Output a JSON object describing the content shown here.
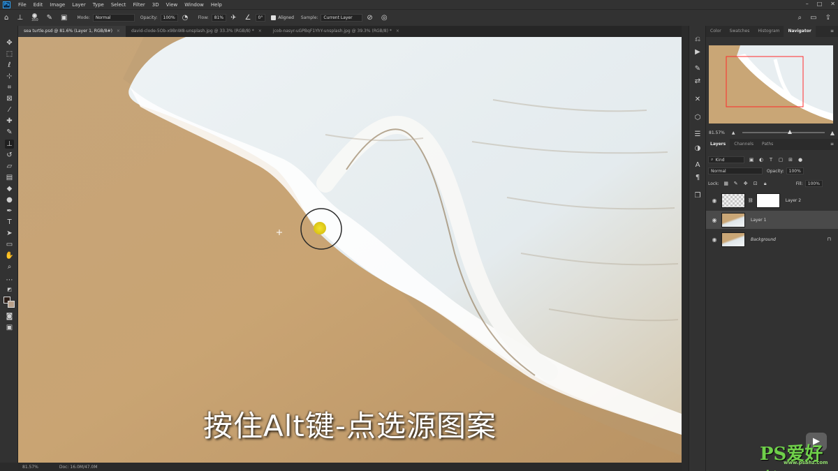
{
  "app": {
    "logo": "Ps"
  },
  "menu": [
    "File",
    "Edit",
    "Image",
    "Layer",
    "Type",
    "Select",
    "Filter",
    "3D",
    "View",
    "Window",
    "Help"
  ],
  "window_controls": [
    "–",
    "□",
    "✕"
  ],
  "options_bar": {
    "brush_size": "350",
    "mode_label": "Mode:",
    "mode_value": "Normal",
    "opacity_label": "Opacity:",
    "opacity_value": "100%",
    "flow_label": "Flow:",
    "flow_value": "81%",
    "angle_value": "0°",
    "aligned_label": "Aligned",
    "sample_label": "Sample:",
    "sample_value": "Current Layer"
  },
  "tabs": [
    {
      "label": "sea turtle.psd @ 81.6% (Layer 1, RGB/8#)",
      "active": true
    },
    {
      "label": "david-clode-5Ob-x9BnW8-unsplash.jpg @ 33.3% (RGB/8) *",
      "active": false
    },
    {
      "label": "jcob-nasyr-uGPBqF1YhY-unsplash.jpg @ 39.3% (RGB/8) *",
      "active": false
    }
  ],
  "canvas": {
    "subtitle": "按住Alt键-点选源图案"
  },
  "status": {
    "zoom": "81.57%",
    "doc": "Doc: 16.0M/47.0M"
  },
  "panels": {
    "top_tabs": [
      "Color",
      "Swatches",
      "Histogram",
      "Navigator"
    ],
    "active_top_tab": "Navigator",
    "navigator_zoom": "81.57%",
    "navigator_zoom_fraction": 0.58,
    "layers_tabs": [
      "Layers",
      "Channels",
      "Paths"
    ],
    "active_layers_tab": "Layers",
    "filter_kind": "Kind",
    "blend_mode": "Normal",
    "opacity_label": "Opacity:",
    "opacity_value": "100%",
    "lock_label": "Lock:",
    "fill_label": "Fill:",
    "fill_value": "100%",
    "layers": [
      {
        "name": "Layer 2",
        "selected": false,
        "has_mask": true
      },
      {
        "name": "Layer 1",
        "selected": true,
        "has_mask": false
      },
      {
        "name": "Background",
        "selected": false,
        "has_mask": false,
        "locked": true
      }
    ]
  },
  "watermark": {
    "text": "PS爱好者",
    "url": "www.psahz.com"
  },
  "colors": {
    "ui_dark": "#323232",
    "ui_darker": "#262626",
    "accent_blue": "#31a8ff",
    "sampling_dot": "#e5d21a",
    "sand": "#c9a676",
    "foam": "#f2f4f5"
  }
}
